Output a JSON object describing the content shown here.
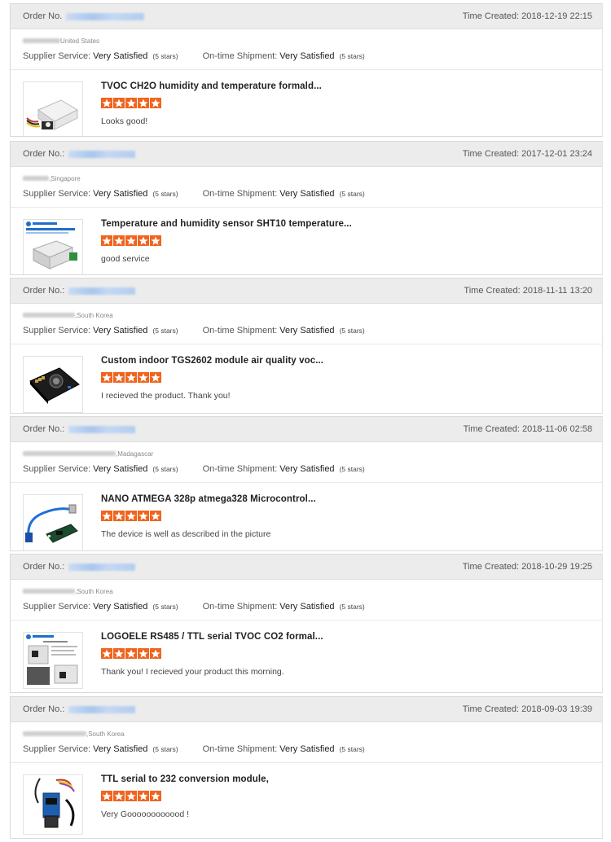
{
  "labels": {
    "order_no": "Order No.",
    "order_no_colon": "Order No.:",
    "time_created": "Time Created:",
    "supplier_service": "Supplier Service:",
    "shipment": "On-time Shipment:"
  },
  "reviews": [
    {
      "time": "2018-12-19 22:15",
      "country": "United States",
      "supplier": "Very Satisfied",
      "supplier_stars": "(5 stars)",
      "shipment": "Very Satisfied",
      "shipment_stars": "(5 stars)",
      "product": "TVOC CH2O humidity and temperature formald...",
      "rating": 5,
      "feedback": "Looks good!",
      "thumb_icon": "sensor-module-white-box"
    },
    {
      "time": "2017-12-01 23:24",
      "country": ",Singapore",
      "supplier": "Very Satisfied",
      "supplier_stars": "(5 stars)",
      "shipment": "Very Satisfied",
      "shipment_stars": "(5 stars)",
      "product": "Temperature and humidity sensor SHT10 temperature...",
      "rating": 5,
      "feedback": "good service",
      "thumb_icon": "transmitter-box"
    },
    {
      "time": "2018-11-11 13:20",
      "country": ",South Korea",
      "supplier": "Very Satisfied",
      "supplier_stars": "(5 stars)",
      "shipment": "Very Satisfied",
      "shipment_stars": "(5 stars)",
      "product": "Custom indoor TGS2602 module air quality voc...",
      "rating": 5,
      "feedback": "I recieved the product. Thank you!",
      "thumb_icon": "black-sensor-board"
    },
    {
      "time": "2018-11-06 02:58",
      "country": ",Madagascar",
      "supplier": "Very Satisfied",
      "supplier_stars": "(5 stars)",
      "shipment": "Very Satisfied",
      "shipment_stars": "(5 stars)",
      "product": "NANO ATMEGA 328p atmega328 Microcontrol...",
      "rating": 5,
      "feedback": "The device is well as described in the picture",
      "thumb_icon": "nano-board-usb-cable"
    },
    {
      "time": "2018-10-29 19:25",
      "country": ",South Korea",
      "supplier": "Very Satisfied",
      "supplier_stars": "(5 stars)",
      "shipment": "Very Satisfied",
      "shipment_stars": "(5 stars)",
      "product": "LOGOELE RS485 / TTL serial TVOC CO2 formal...",
      "rating": 5,
      "feedback": "Thank you! I recieved your product this morning.",
      "thumb_icon": "sensor-product-sheet"
    },
    {
      "time": "2018-09-03 19:39",
      "country": ",South Korea",
      "supplier": "Very Satisfied",
      "supplier_stars": "(5 stars)",
      "shipment": "Very Satisfied",
      "shipment_stars": "(5 stars)",
      "product": "TTL serial to 232 conversion module,",
      "rating": 5,
      "feedback": "Very Goooooooooood !",
      "thumb_icon": "rs232-module-cable"
    }
  ],
  "colors": {
    "star": "#f0641e",
    "header_bg": "#ececec"
  }
}
